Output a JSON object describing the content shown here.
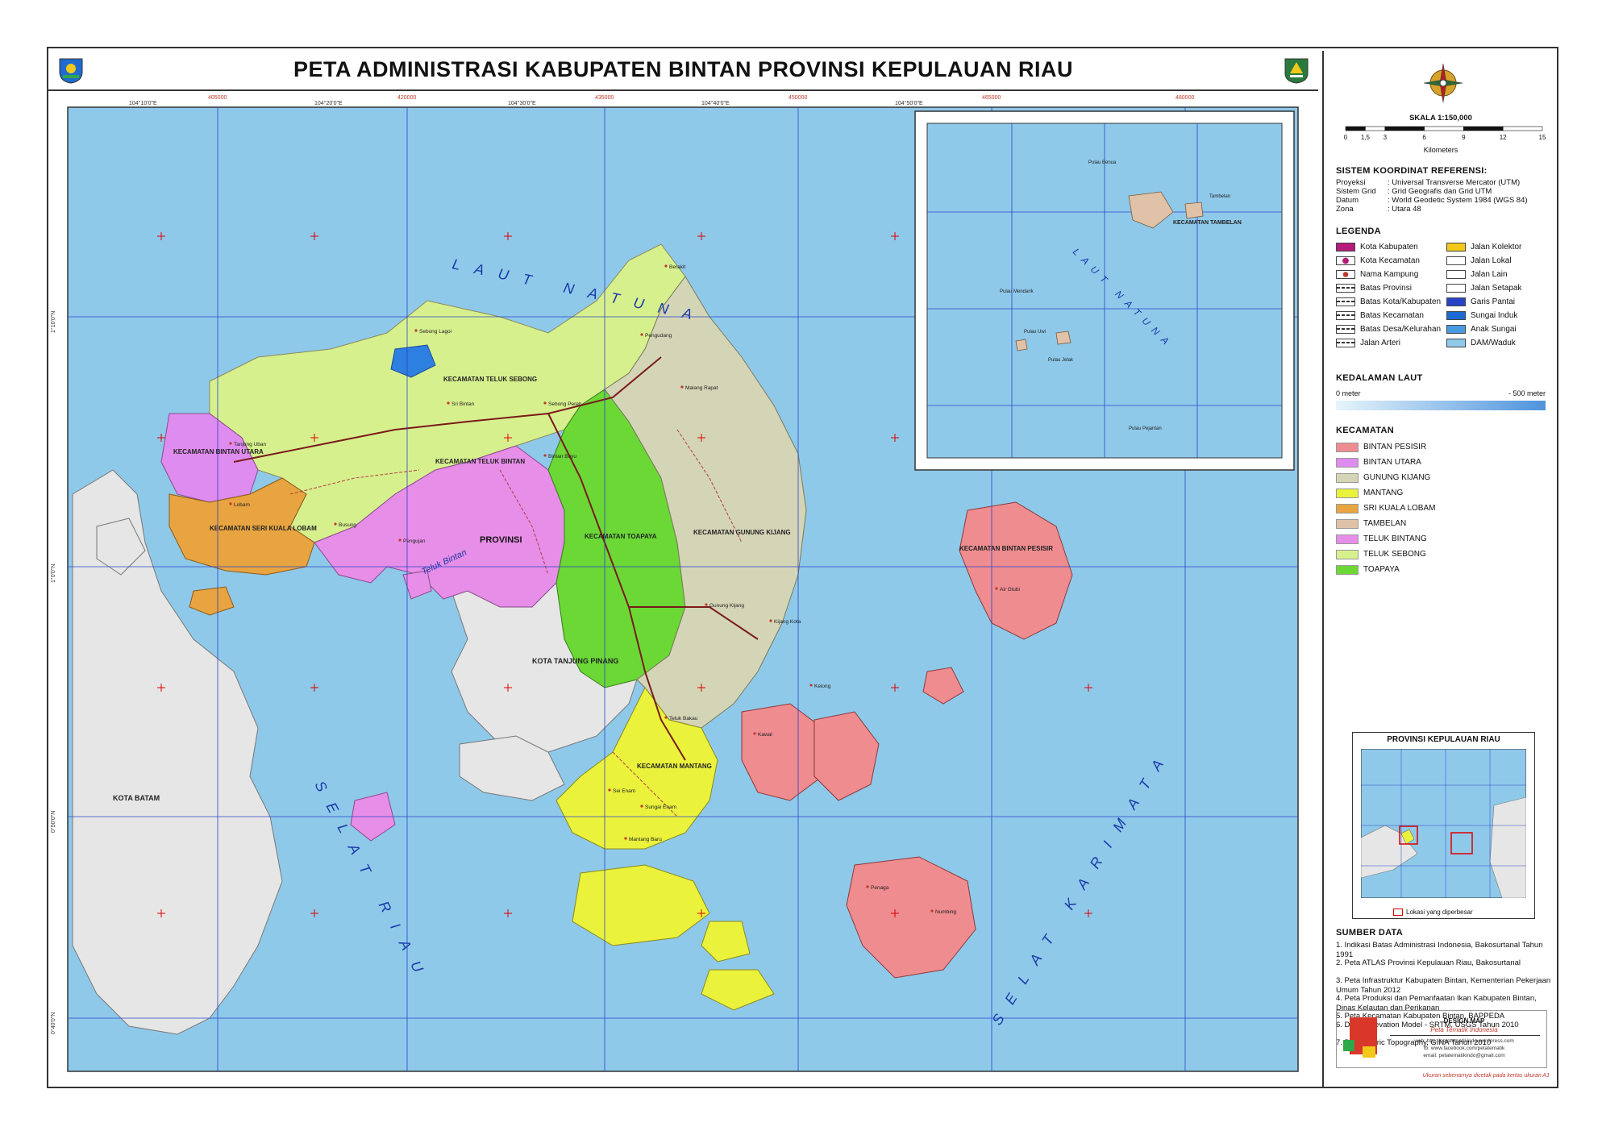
{
  "title": "PETA ADMINISTRASI KABUPATEN BINTAN PROVINSI KEPULAUAN RIAU",
  "colors": {
    "sea": "#8fc9ea",
    "grid": "#2a44c8",
    "bintan_pesisir": "#ee8c8f",
    "bintan_utara": "#df8cf0",
    "gunung_kijang": "#d4d5b6",
    "mantang": "#eaf23c",
    "sri_kuala_lobam": "#e8a440",
    "tambelan": "#e0c2a8",
    "teluk_bintang": "#e78ee8",
    "teluk_sebong": "#d7f08e",
    "toapaya": "#6bd836",
    "other_land": "#e6e6e6"
  },
  "map_labels": {
    "laut_natuna": "LAUT NATUNA",
    "selat_riau": "SELAT RIAU",
    "selat_karimata": "SELAT KARIMATA",
    "teluk_bintan": "Teluk Bintan",
    "kota_batam": "KOTA BATAM",
    "kota_tanjung_pinang": "KOTA TANJUNG PINANG",
    "kec_teluk_sebong": "KECAMATAN TELUK SEBONG",
    "kec_bintan_utara": "KECAMATAN BINTAN UTARA",
    "kec_teluk_bintan": "KECAMATAN TELUK BINTAN",
    "kec_seri_kuala_lobam": "KECAMATAN SERI KUALA LOBAM",
    "kec_toapaya": "KECAMATAN TOAPAYA",
    "kec_gunung_kijang": "KECAMATAN GUNUNG KIJANG",
    "kec_bintan_pesisir": "KECAMATAN BINTAN PESISIR",
    "kec_mantang": "KECAMATAN MANTANG",
    "provinsi": "PROVINSI"
  },
  "place_labels": [
    "Sebong Lagoi",
    "Sri Bintan",
    "Sebong Pereh",
    "Berakit",
    "Pengudang",
    "Malang Rapat",
    "Bintan Buyu",
    "Tanjung Uban",
    "Lobam",
    "Busung",
    "Gunung Kijang",
    "Teluk Bakau",
    "Kawal",
    "Numbing",
    "Mantang Baru",
    "Air Glubi",
    "Kelong",
    "Penaga",
    "Pengujan",
    "Sei Enam",
    "Kijang Kota",
    "Sungai Enam"
  ],
  "coords": {
    "top_lon": [
      "104°10'0\"E",
      "104°20'0\"E",
      "104°30'0\"E",
      "104°40'0\"E",
      "104°50'0\"E"
    ],
    "top_utm": [
      "405000",
      "420000",
      "435000",
      "450000",
      "465000",
      "480000"
    ],
    "left_lat": [
      "1°10'0\"N",
      "1°0'0\"N",
      "0°50'0\"N",
      "0°40'0\"N"
    ]
  },
  "inset_tambelan": {
    "laut_natuna": "LAUT NATUNA",
    "kec_label": "KECAMATAN TAMBELAN",
    "places": [
      "Tambelan",
      "Pulau Benua",
      "Pulau Mendarik",
      "Pulau Uwi",
      "Pulau Jelak",
      "Pulau Pejantan"
    ]
  },
  "scale": {
    "label": "SKALA  1:150,000",
    "ticks": [
      "0",
      "1,5",
      "3",
      "6",
      "9",
      "12",
      "15"
    ],
    "unit": "Kilometers"
  },
  "crs": {
    "title": "SISTEM KOORDINAT REFERENSI:",
    "rows": [
      {
        "k": "Proyeksi",
        "v": ": Universal Transverse Mercator (UTM)"
      },
      {
        "k": "Sistem Grid",
        "v": ": Grid Geografis dan Grid UTM"
      },
      {
        "k": "Datum",
        "v": ": World Geodetic System 1984 (WGS 84)"
      },
      {
        "k": "Zona",
        "v": ": Utara 48"
      }
    ]
  },
  "legend": {
    "title": "LEGENDA",
    "left": [
      "Kota Kabupaten",
      "Kota Kecamatan",
      "Nama Kampung",
      "Batas Provinsi",
      "Batas Kota/Kabupaten",
      "Batas Kecamatan",
      "Batas Desa/Kelurahan",
      "Jalan Arteri"
    ],
    "right": [
      "Jalan Kolektor",
      "Jalan Lokal",
      "Jalan Lain",
      "Jalan Setapak",
      "Garis Pantai",
      "Sungai Induk",
      "Anak Sungai",
      "DAM/Waduk"
    ]
  },
  "depth": {
    "title": "KEDALAMAN LAUT",
    "min": "0 meter",
    "max": "- 500 meter"
  },
  "kecamatan": {
    "title": "KECAMATAN",
    "items": [
      "BINTAN PESISIR",
      "BINTAN UTARA",
      "GUNUNG KIJANG",
      "MANTANG",
      "SRI KUALA LOBAM",
      "TAMBELAN",
      "TELUK BINTANG",
      "TELUK SEBONG",
      "TOAPAYA"
    ]
  },
  "inset_provinsi": {
    "title": "PROVINSI KEPULAUAN RIAU",
    "caption": "Lokasi yang diperbesar"
  },
  "sources": {
    "title": "SUMBER DATA",
    "items": [
      "1. Indikasi Batas Administrasi Indonesia, Bakosurtanal Tahun 1991",
      "2. Peta ATLAS Provinsi Kepulauan Riau, Bakosurtanal",
      "3. Peta Infrastruktur Kabupaten Bintan, Kementerian Pekerjaan Umum Tahun 2012",
      "4. Peta Produksi dan Pemanfaatan Ikan Kabupaten Bintan, Dinas Kelautan dan Perikanan",
      "5. Peta Kecamatan Kabupaten Bintan, BAPPEDA",
      "6. Digital Elevation Model - SRTM, USGS Tahun 2010",
      "7. Bathymetric Topography, GINA Tahun 2010"
    ]
  },
  "design": {
    "title": "DESIGN MAP",
    "subtitle": "Peta Tematik Indonesia",
    "lines": [
      "web: http://petatematikindo.wordpress.com",
      "fb: www.facebook.com/petatematik",
      "email: petatematikindo@gmail.com"
    ],
    "footer": "Ukuran sebenarnya dicetak pada kertas ukuran A1"
  }
}
